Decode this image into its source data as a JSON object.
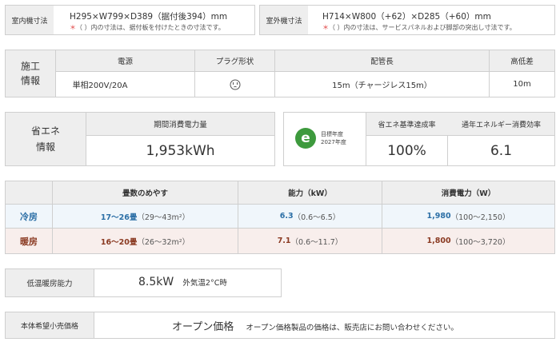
{
  "indoor": {
    "label": "室内機寸法",
    "dims": "H295×W799×D389（据付後394）mm",
    "note_mark": "＊",
    "note": "（ ）内の寸法は、据付板を付けたときの寸法です。"
  },
  "outdoor": {
    "label": "室外機寸法",
    "dims": "H714×W800（+62）×D285（+60）mm",
    "note_mark": "＊",
    "note": "（ ）内の寸法は、サービスパネルおよび脚部の突出し寸法です。"
  },
  "install": {
    "label_line1": "施工",
    "label_line2": "情報",
    "headers": [
      "電源",
      "プラグ形状",
      "配管長",
      "高低差"
    ],
    "power": "単相200V/20A",
    "plug_icon": "plug-outlet-icon",
    "pipe": "15m（チャージレス15m）",
    "height_diff": "10m"
  },
  "energy": {
    "label_line1": "省エネ",
    "label_line2": "情報",
    "annual_header": "期間消費電力量",
    "annual_value": "1,953kWh",
    "target_year_line1": "目標年度",
    "target_year_line2": "2027年度",
    "target_logo_letter": "e",
    "rate_header": "省エネ基準達成率",
    "rate_value": "100%",
    "apf_header": "通年エネルギー消費効率",
    "apf_value": "6.1"
  },
  "capacity": {
    "headers": [
      "畳数のめやす",
      "能力（kW）",
      "消費電力（W）"
    ],
    "cooling": {
      "label": "冷房",
      "tatami_main": "17〜26畳",
      "tatami_sub": "（29〜43m²）",
      "kw_main": "6.3",
      "kw_sub": "（0.6〜6.5）",
      "w_main": "1,980",
      "w_sub": "（100〜2,150）"
    },
    "heating": {
      "label": "暖房",
      "tatami_main": "16〜20畳",
      "tatami_sub": "（26〜32m²）",
      "kw_main": "7.1",
      "kw_sub": "（0.6〜11.7）",
      "w_main": "1,800",
      "w_sub": "（100〜3,720）"
    },
    "colors": {
      "cooling": "#2c6fa6",
      "heating": "#8a3a22"
    }
  },
  "low_temp": {
    "label": "低温暖房能力",
    "value": "8.5kW",
    "condition": "外気温2°C時"
  },
  "price": {
    "label": "本体希望小売価格",
    "value": "オープン価格",
    "note": "オープン価格製品の価格は、販売店にお問い合わせください。"
  }
}
